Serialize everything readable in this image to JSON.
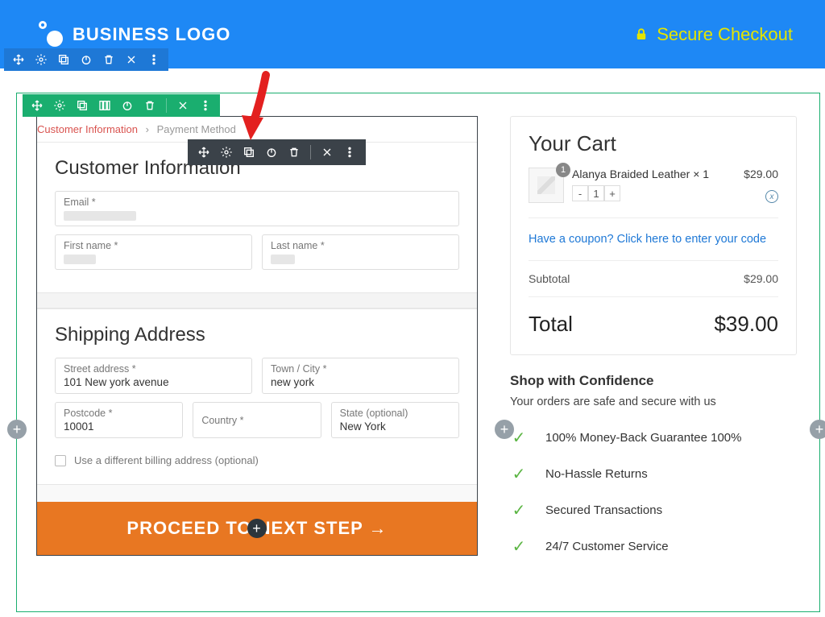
{
  "header": {
    "logo_text": "BUSINESS LOGO",
    "secure_label": "Secure Checkout"
  },
  "breadcrumb": {
    "step1": "Customer Information",
    "step2": "Payment Method"
  },
  "customer_info": {
    "heading": "Customer Information",
    "email_label": "Email *",
    "firstname_label": "First name *",
    "lastname_label": "Last name *"
  },
  "shipping": {
    "heading": "Shipping Address",
    "street_label": "Street address *",
    "street_value": "101 New york avenue",
    "town_label": "Town / City *",
    "town_value": "new york",
    "postcode_label": "Postcode *",
    "postcode_value": "10001",
    "country_label": "Country *",
    "state_label": "State (optional)",
    "state_value": "New York",
    "diff_billing_label": "Use a different billing address (optional)"
  },
  "proceed_label": "PROCEED TO NEXT STEP →",
  "cart": {
    "heading": "Your Cart",
    "item_name": "Alanya Braided Leather × 1",
    "item_qty_badge": "1",
    "item_price": "$29.00",
    "qty_minus": "-",
    "qty_value": "1",
    "qty_plus": "+",
    "coupon_text": "Have a coupon? Click here to enter your code",
    "subtotal_label": "Subtotal",
    "subtotal_value": "$29.00",
    "total_label": "Total",
    "total_value": "$39.00"
  },
  "confidence": {
    "heading": "Shop with Confidence",
    "sub": "Your orders are safe and secure with us",
    "items": [
      "100% Money-Back Guarantee 100%",
      "No-Hassle Returns",
      "Secured Transactions",
      "24/7 Customer Service"
    ]
  }
}
